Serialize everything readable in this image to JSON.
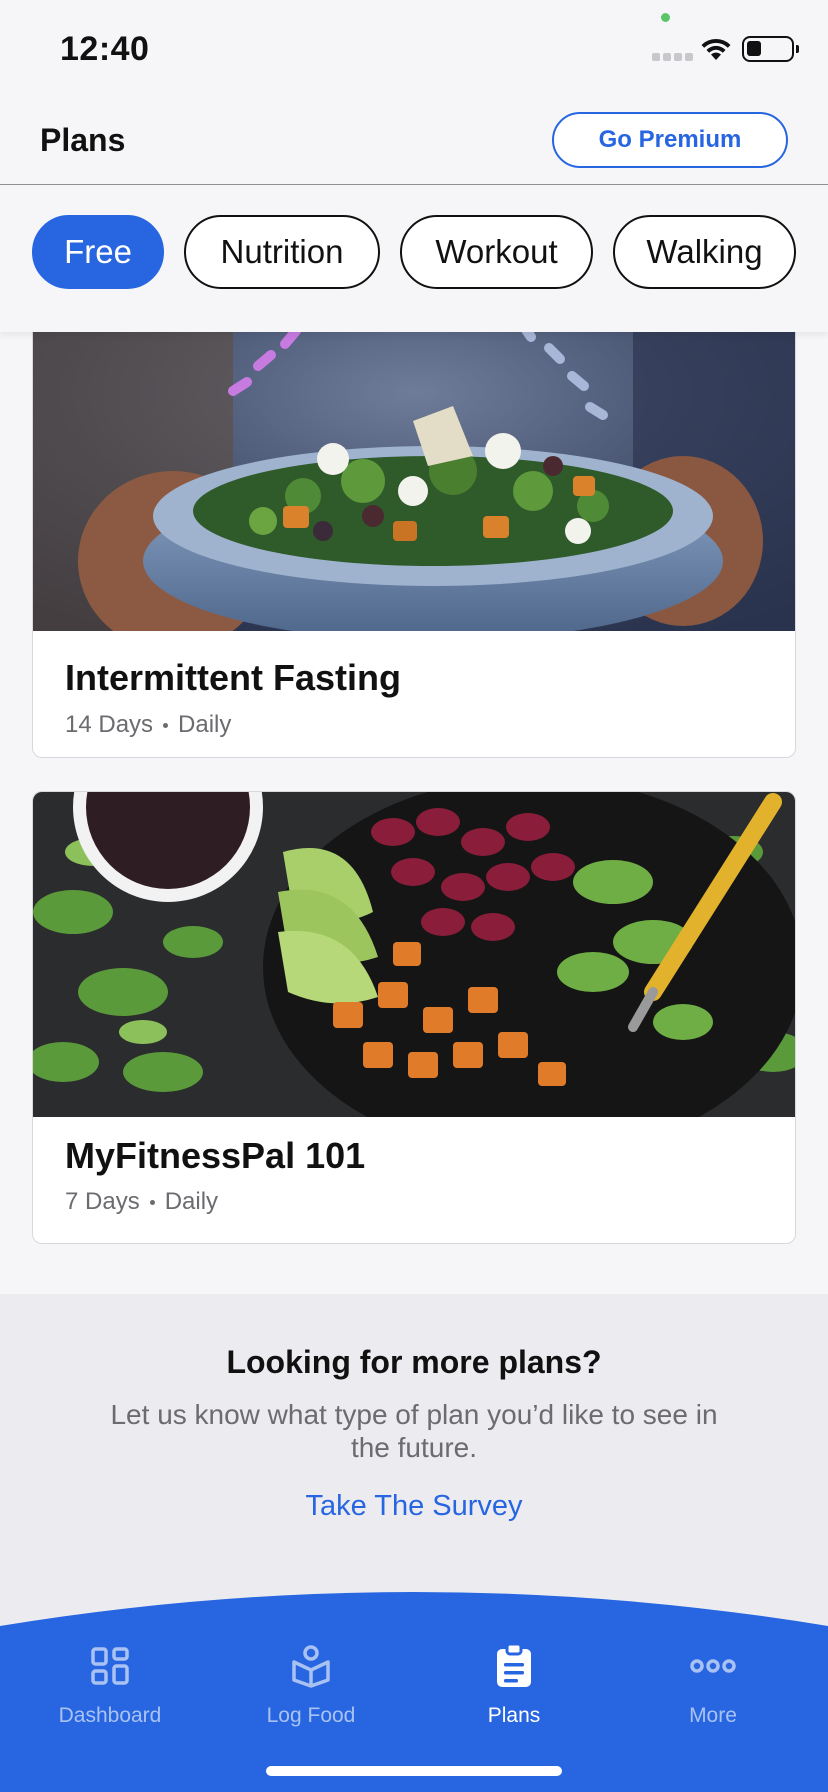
{
  "status_bar": {
    "time": "12:40"
  },
  "header": {
    "title": "Plans",
    "premium_label": "Go Premium"
  },
  "filters": [
    {
      "label": "Free",
      "active": true
    },
    {
      "label": "Nutrition",
      "active": false
    },
    {
      "label": "Workout",
      "active": false
    },
    {
      "label": "Walking",
      "active": false
    }
  ],
  "plans": [
    {
      "title": "Intermittent Fasting",
      "duration": "14 Days",
      "frequency": "Daily"
    },
    {
      "title": "MyFitnessPal 101",
      "duration": "7 Days",
      "frequency": "Daily"
    }
  ],
  "more_plans": {
    "title": "Looking for more plans?",
    "body": "Let us know what type of plan you’d like to see in the future.",
    "link": "Take The Survey"
  },
  "tabbar": {
    "items": [
      {
        "label": "Dashboard",
        "icon": "dashboard-icon",
        "active": false
      },
      {
        "label": "Log Food",
        "icon": "log-food-icon",
        "active": false
      },
      {
        "label": "Plans",
        "icon": "plans-icon",
        "active": true
      },
      {
        "label": "More",
        "icon": "more-icon",
        "active": false
      }
    ]
  },
  "colors": {
    "accent": "#2766e0",
    "background": "#f6f6f8",
    "section": "#ececf0"
  }
}
